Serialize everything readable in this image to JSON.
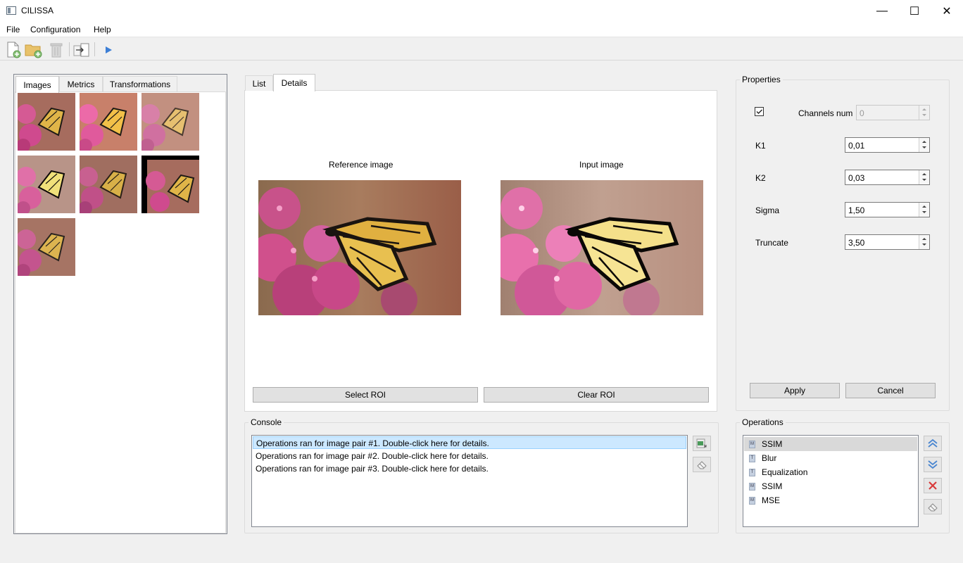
{
  "window": {
    "title": "CILISSA",
    "minimize": "—",
    "maximize": "☐",
    "close": "✕"
  },
  "menu": {
    "items": [
      "File",
      "Configuration",
      "Help"
    ]
  },
  "toolbar": {
    "icons": [
      "new-file-icon",
      "open-folder-icon",
      "delete-icon",
      "import-icon",
      "run-icon"
    ]
  },
  "left_tabs": [
    "Images",
    "Metrics",
    "Transformations"
  ],
  "center_tabs": [
    "List",
    "Details"
  ],
  "details": {
    "reference_label": "Reference image",
    "input_label": "Input image",
    "select_roi": "Select ROI",
    "clear_roi": "Clear ROI"
  },
  "properties": {
    "title": "Properties",
    "channels_label": "Channels num",
    "channels_value": "0",
    "channels_checked": true,
    "k1_label": "K1",
    "k1_value": "0,01",
    "k2_label": "K2",
    "k2_value": "0,03",
    "sigma_label": "Sigma",
    "sigma_value": "1,50",
    "truncate_label": "Truncate",
    "truncate_value": "3,50",
    "apply": "Apply",
    "cancel": "Cancel"
  },
  "console": {
    "title": "Console",
    "lines": [
      "Operations ran for image pair #1. Double-click here for details.",
      "Operations ran for image pair #2. Double-click here for details.",
      "Operations ran for image pair #3. Double-click here for details."
    ]
  },
  "operations": {
    "title": "Operations",
    "items": [
      "SSIM",
      "Blur",
      "Equalization",
      "SSIM",
      "MSE"
    ],
    "icon_letters": [
      "M",
      "T",
      "T",
      "M",
      "M"
    ]
  }
}
